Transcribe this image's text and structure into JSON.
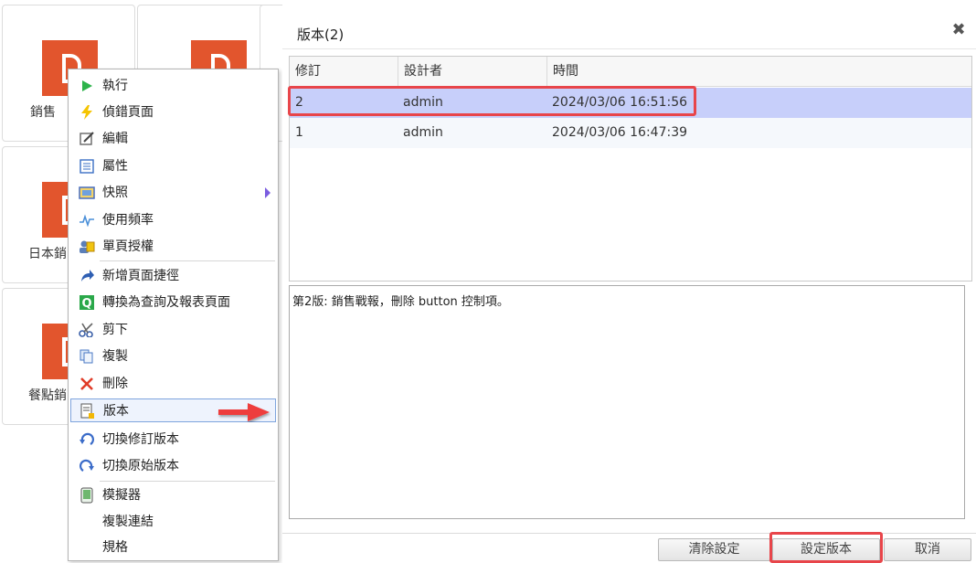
{
  "tiles": [
    {
      "label": "銷售"
    },
    {
      "label": ""
    },
    {
      "label": ""
    },
    {
      "label": "日本銷"
    },
    {
      "label": "餐點銷"
    }
  ],
  "context_menu": {
    "items": [
      {
        "label": "執行",
        "icon": "play-icon"
      },
      {
        "label": "偵錯頁面",
        "icon": "lightning-icon"
      },
      {
        "label": "編輯",
        "icon": "edit-icon"
      },
      {
        "label": "屬性",
        "icon": "properties-icon"
      },
      {
        "label": "快照",
        "icon": "snapshot-icon"
      },
      {
        "label": "使用頻率",
        "icon": "frequency-icon"
      },
      {
        "label": "單頁授權",
        "icon": "authorize-icon"
      },
      {
        "label": "新增頁面捷徑",
        "icon": "shortcut-icon"
      },
      {
        "label": "轉換為查詢及報表頁面",
        "icon": "query-icon"
      },
      {
        "label": "剪下",
        "icon": "scissors-icon"
      },
      {
        "label": "複製",
        "icon": "copy-icon"
      },
      {
        "label": "刪除",
        "icon": "delete-icon"
      },
      {
        "label": "版本",
        "icon": "version-icon"
      },
      {
        "label": "切換修訂版本",
        "icon": "switch-revision-icon"
      },
      {
        "label": "切換原始版本",
        "icon": "switch-original-icon"
      },
      {
        "label": "模擬器",
        "icon": "simulator-icon"
      },
      {
        "label": "複製連結",
        "icon": ""
      },
      {
        "label": "規格",
        "icon": ""
      }
    ]
  },
  "dialog": {
    "title": "版本(2)",
    "close_glyph": "✖",
    "columns": [
      "修訂",
      "設計者",
      "時間"
    ],
    "rows": [
      {
        "revision": "2",
        "designer": "admin",
        "time": "2024/03/06 16:51:56"
      },
      {
        "revision": "1",
        "designer": "admin",
        "time": "2024/03/06 16:47:39"
      }
    ],
    "note": "第2版: 銷售戰報，刪除 button 控制項。",
    "buttons": {
      "clear": "清除設定",
      "set_version": "設定版本",
      "cancel": "取消"
    }
  },
  "colors": {
    "tile_icon": "#e2552d",
    "selected_row": "#c7cffa",
    "highlight_box": "#e8454a"
  }
}
